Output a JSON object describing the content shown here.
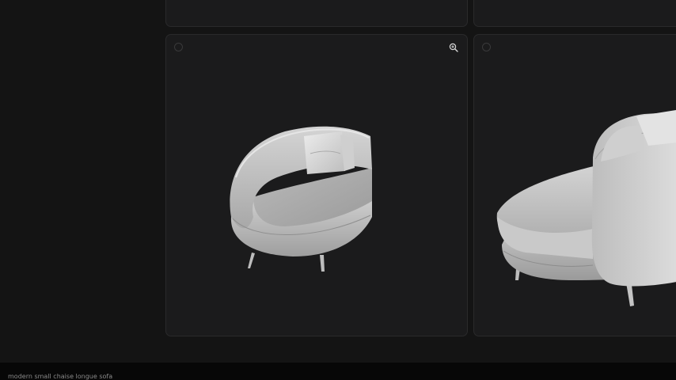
{
  "caption": {
    "text": "modern small chaise longue sofa"
  },
  "gallery": {
    "cards": [
      {
        "name": "result-card-top-1",
        "state": "partially-visible"
      },
      {
        "name": "result-card-top-2",
        "state": "partially-visible"
      },
      {
        "name": "result-card-1",
        "model": "chaise-longue-front-three-quarter-view",
        "icon": "zoom-in-icon"
      },
      {
        "name": "result-card-2",
        "model": "chaise-longue-rear-three-quarter-view"
      }
    ]
  },
  "colors": {
    "background": "#141414",
    "card": "#1b1b1c",
    "card_border": "#2a2a2b",
    "model_surface": "#c9c9c9",
    "caption_bar": "#070707"
  }
}
